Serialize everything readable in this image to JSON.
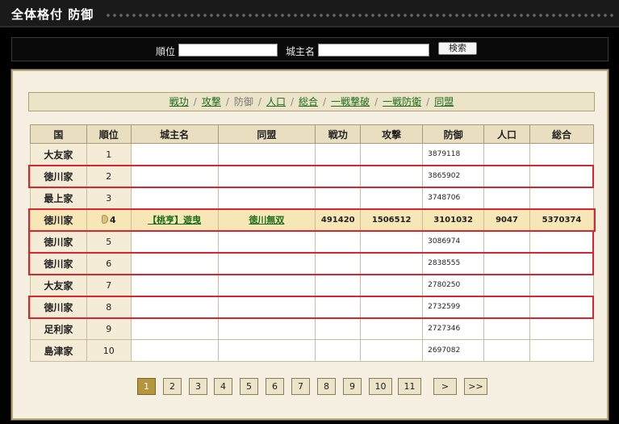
{
  "header": {
    "title": "全体格付 防御"
  },
  "search": {
    "rank_label": "順位",
    "lord_label": "城主名",
    "rank_value": "",
    "lord_value": "",
    "button_label": "検索"
  },
  "tabs": [
    {
      "label": "戦功",
      "link": true
    },
    {
      "label": "攻撃",
      "link": true
    },
    {
      "label": "防御",
      "link": false
    },
    {
      "label": "人口",
      "link": true
    },
    {
      "label": "総合",
      "link": true
    },
    {
      "label": "一戦撃破",
      "link": true
    },
    {
      "label": "一戦防衛",
      "link": true
    },
    {
      "label": "同盟",
      "link": true
    }
  ],
  "table": {
    "headers": [
      "国",
      "順位",
      "城主名",
      "同盟",
      "戦功",
      "攻撃",
      "防御",
      "人口",
      "総合"
    ],
    "rows": [
      {
        "country": "大友家",
        "rank": "1",
        "defense": "3879118",
        "highlight": false
      },
      {
        "country": "徳川家",
        "rank": "2",
        "defense": "3865902",
        "highlight": true
      },
      {
        "country": "最上家",
        "rank": "3",
        "defense": "3748706",
        "highlight": false
      },
      {
        "country": "徳川家",
        "rank": "4",
        "lord": "【桃亨】遊曳",
        "alliance": "徳川無双",
        "merit": "491420",
        "attack": "1506512",
        "defense": "3101032",
        "population": "9047",
        "total": "5370374",
        "self": true,
        "highlight": true
      },
      {
        "country": "徳川家",
        "rank": "5",
        "defense": "3086974",
        "highlight": true
      },
      {
        "country": "徳川家",
        "rank": "6",
        "defense": "2838555",
        "highlight": true
      },
      {
        "country": "大友家",
        "rank": "7",
        "defense": "2780250",
        "highlight": false
      },
      {
        "country": "徳川家",
        "rank": "8",
        "defense": "2732599",
        "highlight": true
      },
      {
        "country": "足利家",
        "rank": "9",
        "defense": "2727346",
        "highlight": false
      },
      {
        "country": "島津家",
        "rank": "10",
        "defense": "2697082",
        "highlight": false
      }
    ]
  },
  "pager": {
    "pages": [
      "1",
      "2",
      "3",
      "4",
      "5",
      "6",
      "7",
      "8",
      "9",
      "10",
      "11"
    ],
    "current": "1",
    "next": ">",
    "last": ">>"
  },
  "colors": {
    "highlight_border": "#d8262e",
    "link": "#1a6a1a",
    "self_row": "#f7e7b6",
    "active_page": "#b5963c"
  }
}
